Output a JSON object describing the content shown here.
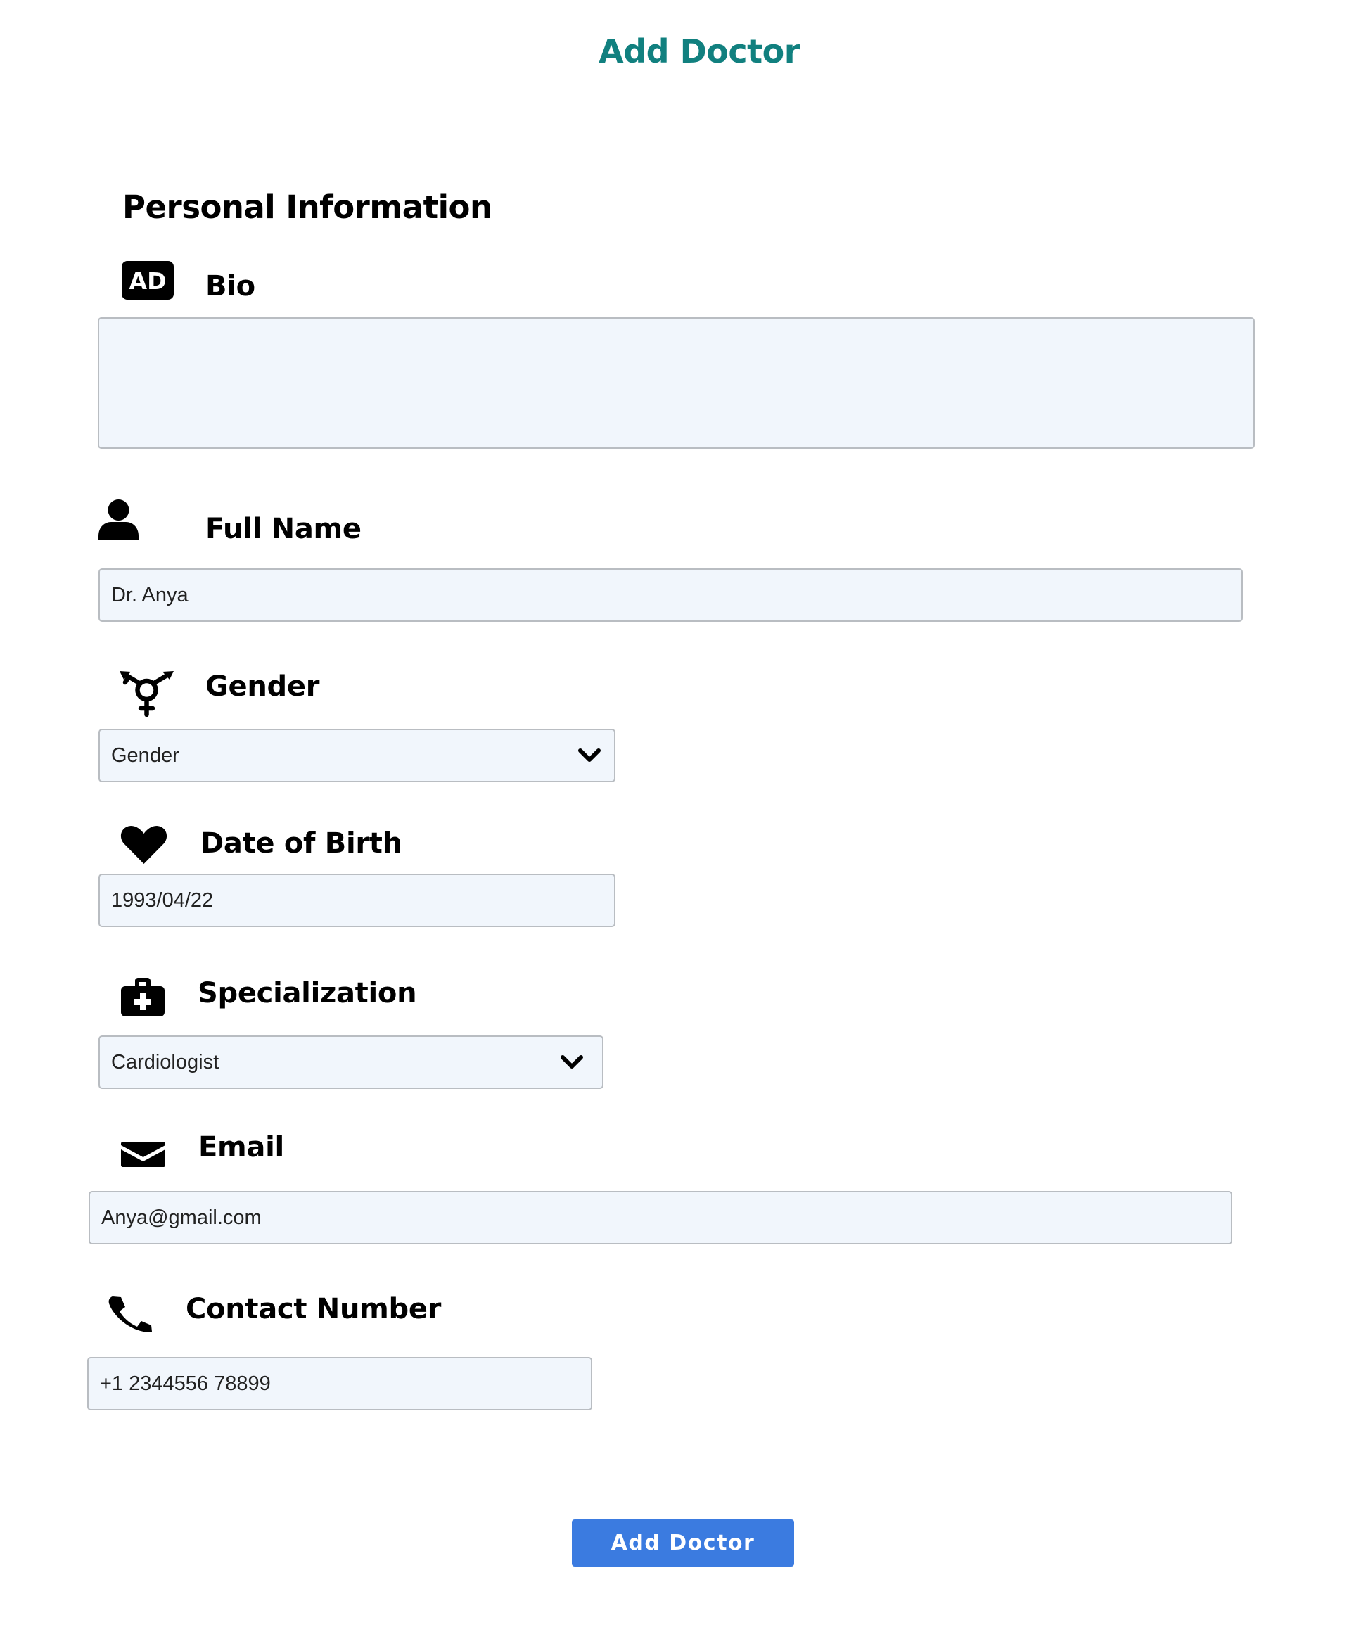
{
  "page": {
    "title": "Add Doctor",
    "accent_color": "#11807f",
    "button_color": "#3b7be0"
  },
  "section": {
    "title": "Personal Information"
  },
  "fields": {
    "bio": {
      "label": "Bio",
      "icon": "ad-badge-icon",
      "icon_text": "AD",
      "value": ""
    },
    "full_name": {
      "label": "Full Name",
      "icon": "person-icon",
      "value": "Dr. Anya"
    },
    "gender": {
      "label": "Gender",
      "icon": "transgender-icon",
      "value": "Gender"
    },
    "dob": {
      "label": "Date of Birth",
      "icon": "heart-icon",
      "value": "1993/04/22"
    },
    "specialization": {
      "label": "Specialization",
      "icon": "medical-kit-icon",
      "value": "Cardiologist"
    },
    "email": {
      "label": "Email",
      "icon": "envelope-icon",
      "value": "Anya@gmail.com"
    },
    "contact": {
      "label": "Contact Number",
      "icon": "phone-icon",
      "value": "+1 2344556 78899"
    }
  },
  "submit": {
    "label": "Add Doctor"
  }
}
